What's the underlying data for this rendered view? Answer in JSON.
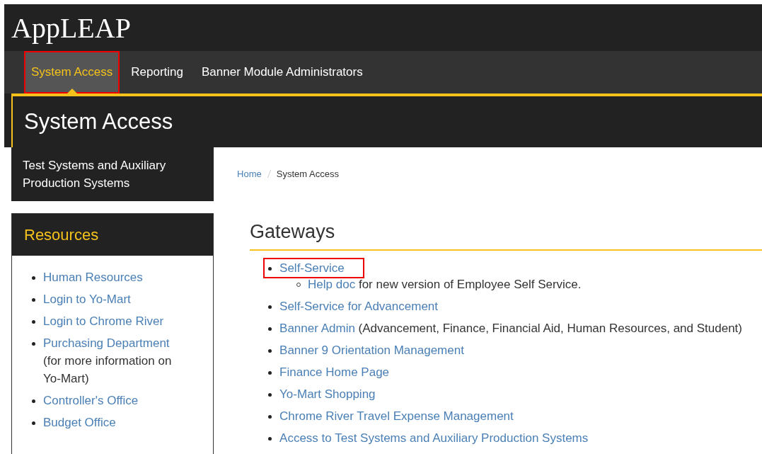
{
  "header": {
    "title": "AppLEAP"
  },
  "nav": {
    "tabs": [
      {
        "label": "System Access",
        "selected": true,
        "highlighted": true
      },
      {
        "label": "Reporting",
        "selected": false,
        "highlighted": false
      },
      {
        "label": "Banner Module Administrators",
        "selected": false,
        "highlighted": false
      }
    ]
  },
  "page_title": "System Access",
  "sidebar": {
    "current_item": "Test Systems and Auxiliary Production Systems",
    "resources": {
      "title": "Resources",
      "items": [
        {
          "link": "Human Resources"
        },
        {
          "link": "Login to Yo-Mart"
        },
        {
          "link": "Login to Chrome River"
        },
        {
          "link": "Purchasing Department",
          "text": "(for more information on Yo-Mart)"
        },
        {
          "link": "Controller's Office"
        },
        {
          "link": "Budget Office"
        }
      ]
    }
  },
  "breadcrumb": [
    {
      "label": "Home",
      "kind": "link"
    },
    {
      "label": "System Access",
      "kind": "current"
    }
  ],
  "gateways": {
    "title": "Gateways",
    "items": [
      {
        "link": "Self-Service",
        "highlighted": true,
        "children": [
          {
            "link": "Help doc",
            "text": "for new version of Employee Self Service."
          }
        ]
      },
      {
        "link": "Self-Service for Advancement",
        "highlighted": false
      },
      {
        "link": "Banner Admin",
        "text": "(Advancement, Finance, Financial Aid, Human Resources, and Student)",
        "highlighted": false
      },
      {
        "link": "Banner 9 Orientation Management",
        "highlighted": false
      },
      {
        "link": "Finance Home Page",
        "highlighted": false
      },
      {
        "link": "Yo-Mart Shopping",
        "highlighted": false
      },
      {
        "link": "Chrome River Travel Expense Management",
        "highlighted": false
      },
      {
        "link": "Access to Test Systems and Auxiliary Production Systems",
        "highlighted": false
      }
    ]
  }
}
